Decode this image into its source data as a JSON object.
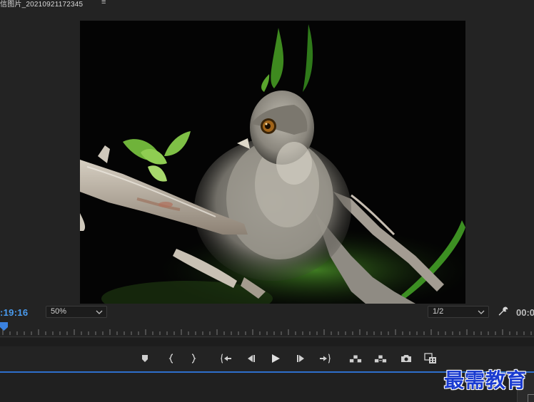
{
  "header": {
    "title": "信图片_20210921172345",
    "menu_glyph": "≡"
  },
  "monitor": {
    "timecode": ":19:16",
    "zoom": "50%",
    "resolution": "1/2",
    "timecode_right": "00:0"
  },
  "transport": {
    "buttons": [
      {
        "name": "add-marker-button",
        "icon": "marker-icon"
      },
      {
        "name": "mark-in-button",
        "icon": "mark-in-icon"
      },
      {
        "name": "mark-out-button",
        "icon": "mark-out-icon"
      },
      {
        "name": "go-to-in-button",
        "icon": "go-to-in-icon"
      },
      {
        "name": "step-back-button",
        "icon": "step-back-icon"
      },
      {
        "name": "play-button",
        "icon": "play-icon"
      },
      {
        "name": "step-forward-button",
        "icon": "step-forward-icon"
      },
      {
        "name": "go-to-out-button",
        "icon": "go-to-out-icon"
      },
      {
        "name": "lift-button",
        "icon": "lift-icon"
      },
      {
        "name": "extract-button",
        "icon": "extract-icon"
      },
      {
        "name": "export-frame-button",
        "icon": "camera-icon"
      },
      {
        "name": "comparison-view-button",
        "icon": "comparison-icon"
      }
    ]
  },
  "colors": {
    "accent_blue": "#4a9cf0",
    "playhead": "#3b82e0",
    "panel_bg": "#232323",
    "watermark": "#1a3bd0"
  },
  "watermark": {
    "text": "最需教育"
  }
}
